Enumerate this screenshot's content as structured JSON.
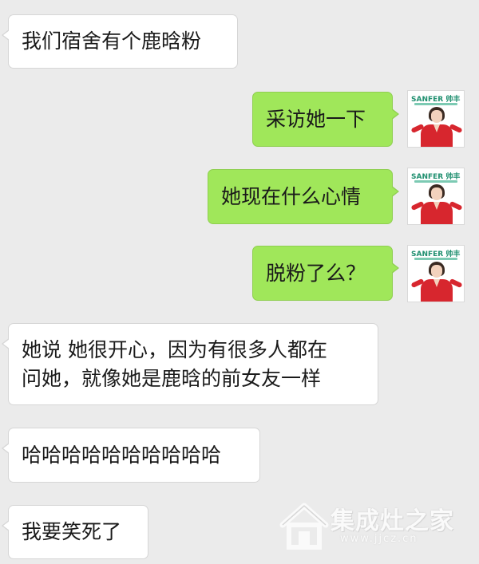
{
  "messages": [
    {
      "side": "in",
      "text": "我们宿舍有个鹿晗粉"
    },
    {
      "side": "out",
      "text": "采访她一下"
    },
    {
      "side": "out",
      "text": "她现在什么心情"
    },
    {
      "side": "out",
      "text": "脱粉了么？"
    },
    {
      "side": "in",
      "text": "她说 她很开心，因为有很多人都在\n问她，就像她是鹿晗的前女友一样"
    },
    {
      "side": "in",
      "text": "哈哈哈哈哈哈哈哈哈哈"
    },
    {
      "side": "in",
      "text": "我要笑死了"
    }
  ],
  "avatar": {
    "brand": "SANFER 帅丰",
    "icon": "person-avatar"
  },
  "watermark": {
    "title": "集成灶之家",
    "url": "www.jjcz.cn",
    "icon": "house-logo"
  },
  "colors": {
    "background": "#ebebeb",
    "incoming_bubble": "#ffffff",
    "outgoing_bubble": "#a0e75a"
  }
}
